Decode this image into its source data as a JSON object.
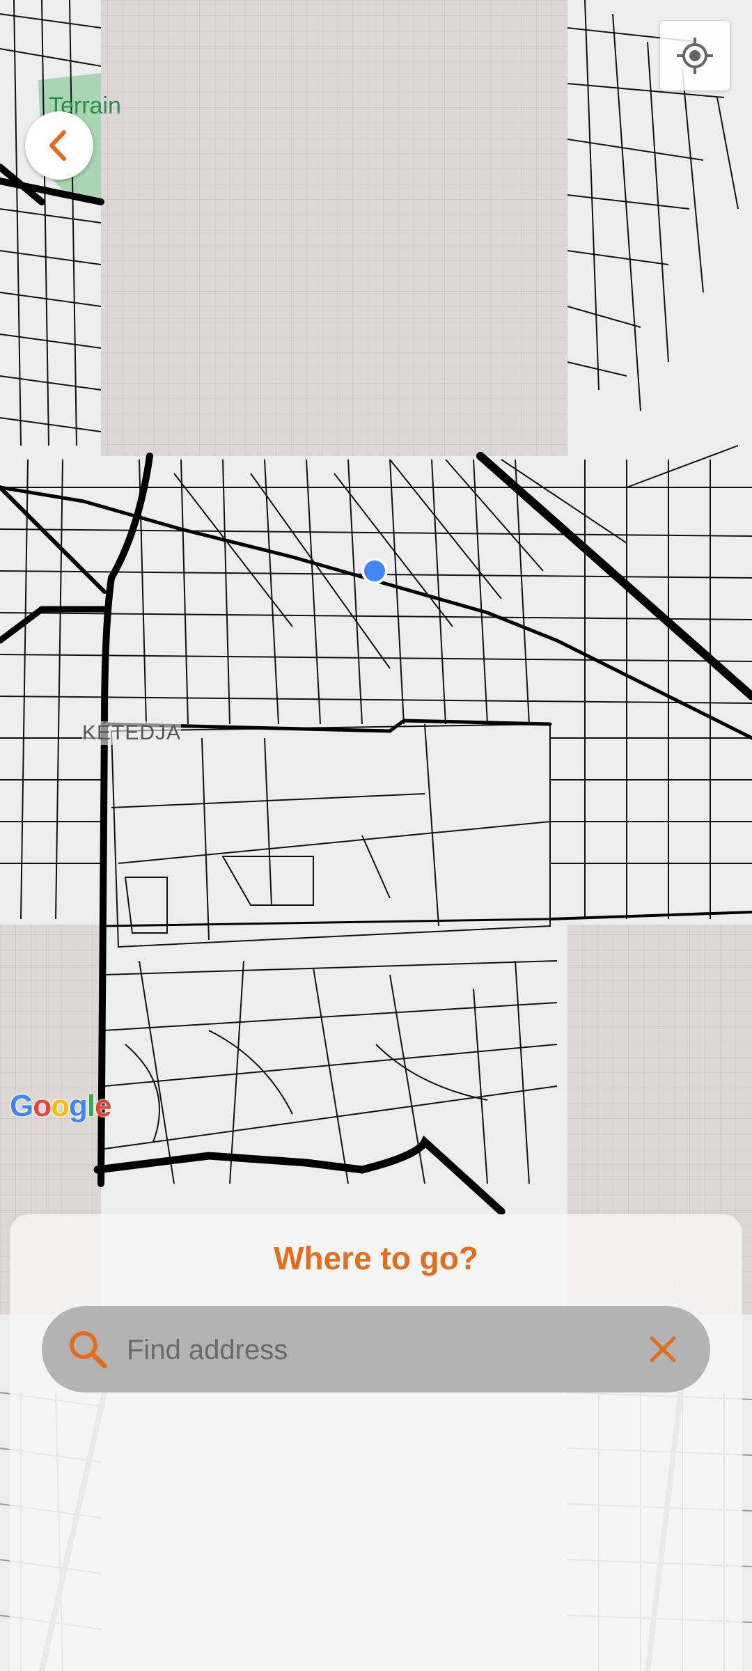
{
  "map": {
    "poi_label": "Terrain\nolfe",
    "district_label": "KÉTEDJA",
    "attribution": {
      "letters": [
        "G",
        "o",
        "o",
        "g",
        "l",
        "e"
      ],
      "colors": [
        "#4285f4",
        "#ea4335",
        "#fbbc05",
        "#4285f4",
        "#34a853",
        "#ea4335"
      ]
    },
    "location_dot_color": "#4285f4"
  },
  "controls": {
    "back_icon": "chevron-left-icon",
    "locate_icon": "crosshair-icon"
  },
  "sheet": {
    "title": "Where to go?",
    "search_placeholder": "Find address",
    "search_value": "",
    "search_icon": "search-icon",
    "clear_icon": "close-icon"
  },
  "colors": {
    "accent": "#e46c1e",
    "search_bg": "#b3b3b3",
    "map_bg": "#ededed",
    "unloaded_tile": "#dcd6d4"
  }
}
